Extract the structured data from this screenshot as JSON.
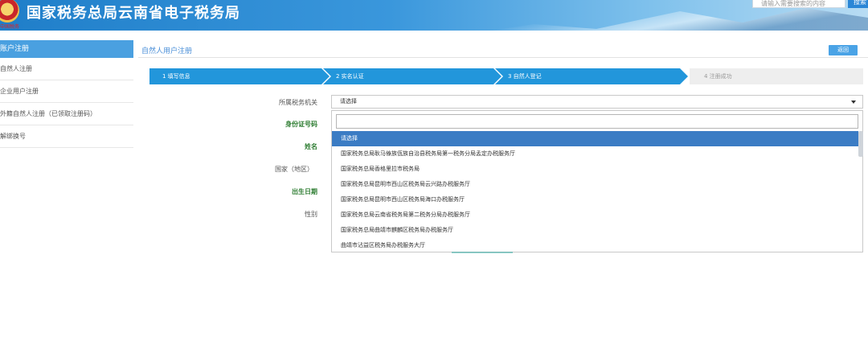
{
  "header": {
    "title": "国家税务总局云南省电子税务局",
    "logo_sub": "中国税务",
    "search": {
      "placeholder": "请输入需要搜索的内容",
      "button": "搜索"
    }
  },
  "sidebar": {
    "head": "账户注册",
    "items": [
      {
        "label": "自然人注册"
      },
      {
        "label": "企业用户注册"
      },
      {
        "label": "外籍自然人注册（已领取注册码）"
      },
      {
        "label": "解绑换号"
      }
    ]
  },
  "main": {
    "title": "自然人用户注册",
    "back_button": "返回",
    "steps": [
      {
        "label": "1  填写信息",
        "state": "active"
      },
      {
        "label": "2  实名认证",
        "state": "active"
      },
      {
        "label": "3  自然人登记",
        "state": "active"
      },
      {
        "label": "4  注册成功",
        "state": "inactive"
      }
    ],
    "form": {
      "tax_office_label": "所属税务机关",
      "tax_office_value": "请选择",
      "id_label": "身份证号码",
      "name_label": "姓名",
      "country_label": "国家（地区）",
      "birth_label": "出生日期",
      "gender_label": "性别"
    },
    "dropdown": {
      "search_value": "",
      "options": [
        {
          "label": "请选择",
          "highlighted": true
        },
        {
          "label": "国家税务总局耿马傣族佤族自治县税务局第一税务分局孟定办税服务厅",
          "highlighted": false
        },
        {
          "label": "国家税务总局香格里拉市税务局",
          "highlighted": false
        },
        {
          "label": "国家税务总局昆明市西山区税务局云兴路办税服务厅",
          "highlighted": false
        },
        {
          "label": "国家税务总局昆明市西山区税务局海口办税服务厅",
          "highlighted": false
        },
        {
          "label": "国家税务总局云南省税务局第二税务分局办税服务厅",
          "highlighted": false
        },
        {
          "label": "国家税务总局曲靖市麒麟区税务局办税服务厅",
          "highlighted": false
        },
        {
          "label": "曲靖市沾益区税务局办税服务大厅",
          "highlighted": false
        }
      ]
    }
  },
  "colors": {
    "brand_blue": "#2296db",
    "sidebar_head": "#4aa0e0",
    "highlight": "#3b7cc4"
  }
}
